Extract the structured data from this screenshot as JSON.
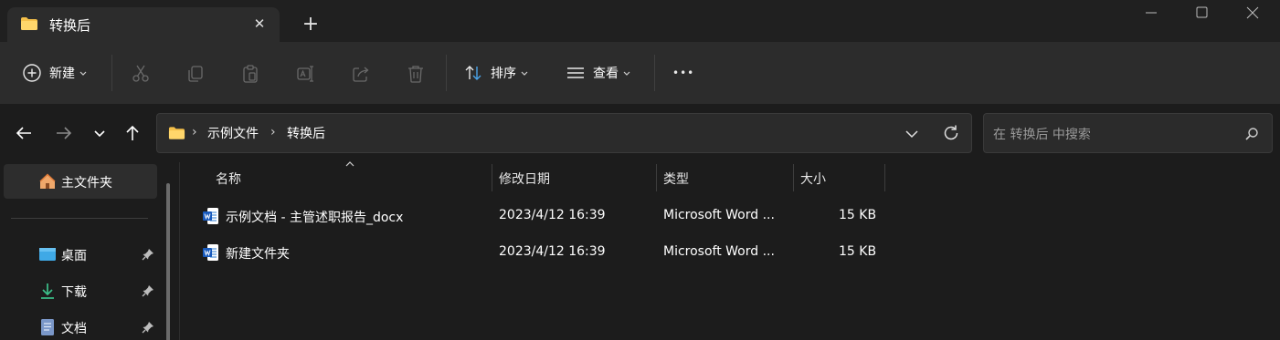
{
  "window": {
    "tab_title": "转换后",
    "tab_close": "✕",
    "new_tab": "+"
  },
  "toolbar": {
    "new_label": "新建",
    "sort_label": "排序",
    "view_label": "查看",
    "more_label": "•••"
  },
  "address": {
    "crumbs": [
      "示例文件",
      "转换后"
    ],
    "separator": "›"
  },
  "search": {
    "placeholder": "在 转换后 中搜索"
  },
  "sidebar": {
    "home": "主文件夹",
    "items": [
      {
        "label": "桌面"
      },
      {
        "label": "下载"
      },
      {
        "label": "文档"
      }
    ]
  },
  "columns": {
    "name": "名称",
    "modified": "修改日期",
    "type": "类型",
    "size": "大小"
  },
  "files": [
    {
      "name": "示例文档 - 主管述职报告_docx",
      "modified": "2023/4/12 16:39",
      "type": "Microsoft Word ...",
      "size": "15 KB"
    },
    {
      "name": "新建文件夹",
      "modified": "2023/4/12 16:39",
      "type": "Microsoft Word ...",
      "size": "15 KB"
    }
  ],
  "colors": {
    "folder": "#f5c04a",
    "accent": "#4aa3e8",
    "background": "#1c1c1c",
    "toolbar": "#2c2c2c"
  }
}
